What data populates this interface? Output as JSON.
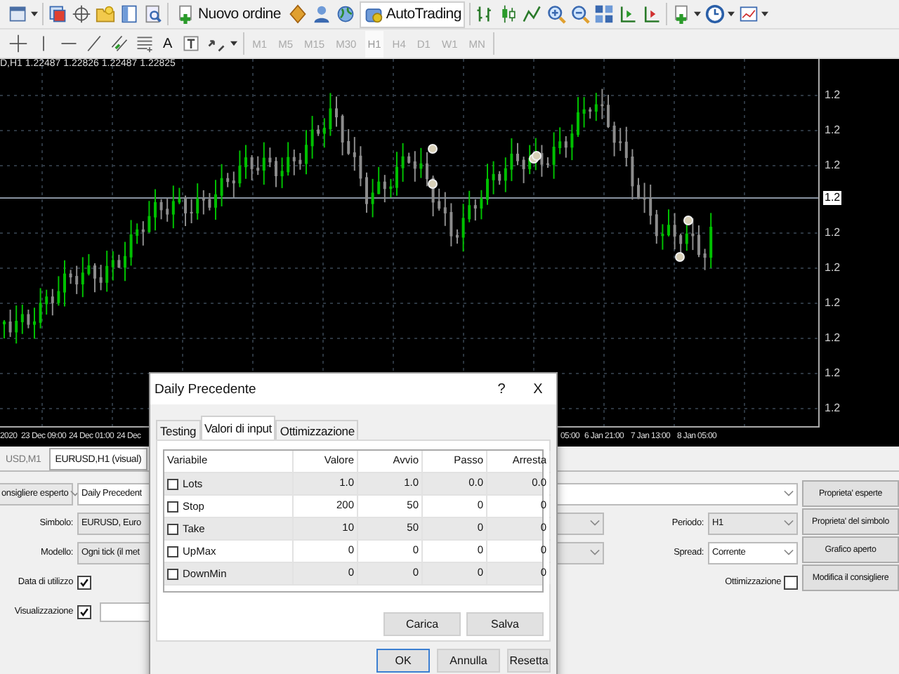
{
  "toolbar": {
    "new_order": "Nuovo ordine",
    "autotrading": "AutoTrading"
  },
  "drawing_tools": {
    "text_tool": "A"
  },
  "timeframes": [
    {
      "label": "M1",
      "selected": false
    },
    {
      "label": "M5",
      "selected": false
    },
    {
      "label": "M15",
      "selected": false
    },
    {
      "label": "M30",
      "selected": false
    },
    {
      "label": "H1",
      "selected": true
    },
    {
      "label": "H4",
      "selected": false
    },
    {
      "label": "D1",
      "selected": false
    },
    {
      "label": "W1",
      "selected": false
    },
    {
      "label": "MN",
      "selected": false
    }
  ],
  "chart": {
    "caption": "D,H1  1.22487 1.22826 1.22487 1.22825",
    "price_labels": [
      {
        "text": "1.2",
        "current": false
      },
      {
        "text": "1.2",
        "current": false
      },
      {
        "text": "1.2",
        "current": false
      },
      {
        "text": "1.2",
        "current": true
      },
      {
        "text": "1.2",
        "current": false
      },
      {
        "text": "1.2",
        "current": false
      },
      {
        "text": "1.2",
        "current": false
      },
      {
        "text": "1.2",
        "current": false
      },
      {
        "text": "1.2",
        "current": false
      },
      {
        "text": "1.2",
        "current": false
      }
    ],
    "time_labels": [
      "2020",
      "23 Dec 09:00",
      "24 Dec 01:00",
      "24 Dec",
      "05:00",
      "6 Jan 21:00",
      "7 Jan 13:00",
      "8 Jan 05:00"
    ]
  },
  "chart_tabs": [
    {
      "label": "USD,M1",
      "selected": false
    },
    {
      "label": "EURUSD,H1 (visual)",
      "selected": true
    }
  ],
  "tester": {
    "mode": "onsigliere esperto",
    "expert": "Daily Precedent",
    "symbol_label": "Simbolo:",
    "symbol": "EURUSD, Euro",
    "model_label": "Modello:",
    "model": "Ogni tick (il met",
    "period_label": "Periodo:",
    "period": "H1",
    "spread_label": "Spread:",
    "spread": "Corrente",
    "use_date": {
      "label": "Data di utilizzo",
      "checked": true
    },
    "visual": {
      "label": "Visualizzazione",
      "checked": true
    },
    "optimization": {
      "label": "Ottimizzazione",
      "checked": false
    },
    "buttons": [
      "Proprieta' esperte",
      "Proprieta' del simbolo",
      "Grafico aperto",
      "Modifica il consigliere"
    ]
  },
  "dialog": {
    "title": "Daily Precedente",
    "help": "?",
    "close": "X",
    "tabs": [
      {
        "label": "Testing",
        "selected": false
      },
      {
        "label": "Valori di input",
        "selected": true
      },
      {
        "label": "Ottimizzazione",
        "selected": false
      }
    ],
    "columns": [
      "Variabile",
      "Valore",
      "Avvio",
      "Passo",
      "Arresta"
    ],
    "rows": [
      {
        "checked": false,
        "cells": [
          "Lots",
          "1.0",
          "1.0",
          "0.0",
          "0.0"
        ]
      },
      {
        "checked": false,
        "cells": [
          "Stop",
          "200",
          "50",
          "0",
          "0"
        ]
      },
      {
        "checked": false,
        "cells": [
          "Take",
          "10",
          "50",
          "0",
          "0"
        ]
      },
      {
        "checked": false,
        "cells": [
          "UpMax",
          "0",
          "0",
          "0",
          "0"
        ]
      },
      {
        "checked": false,
        "cells": [
          "DownMin",
          "0",
          "0",
          "0",
          "0"
        ]
      }
    ],
    "side_buttons": [
      "Carica",
      "Salva"
    ],
    "buttons": [
      "OK",
      "Annulla",
      "Resetta"
    ]
  }
}
